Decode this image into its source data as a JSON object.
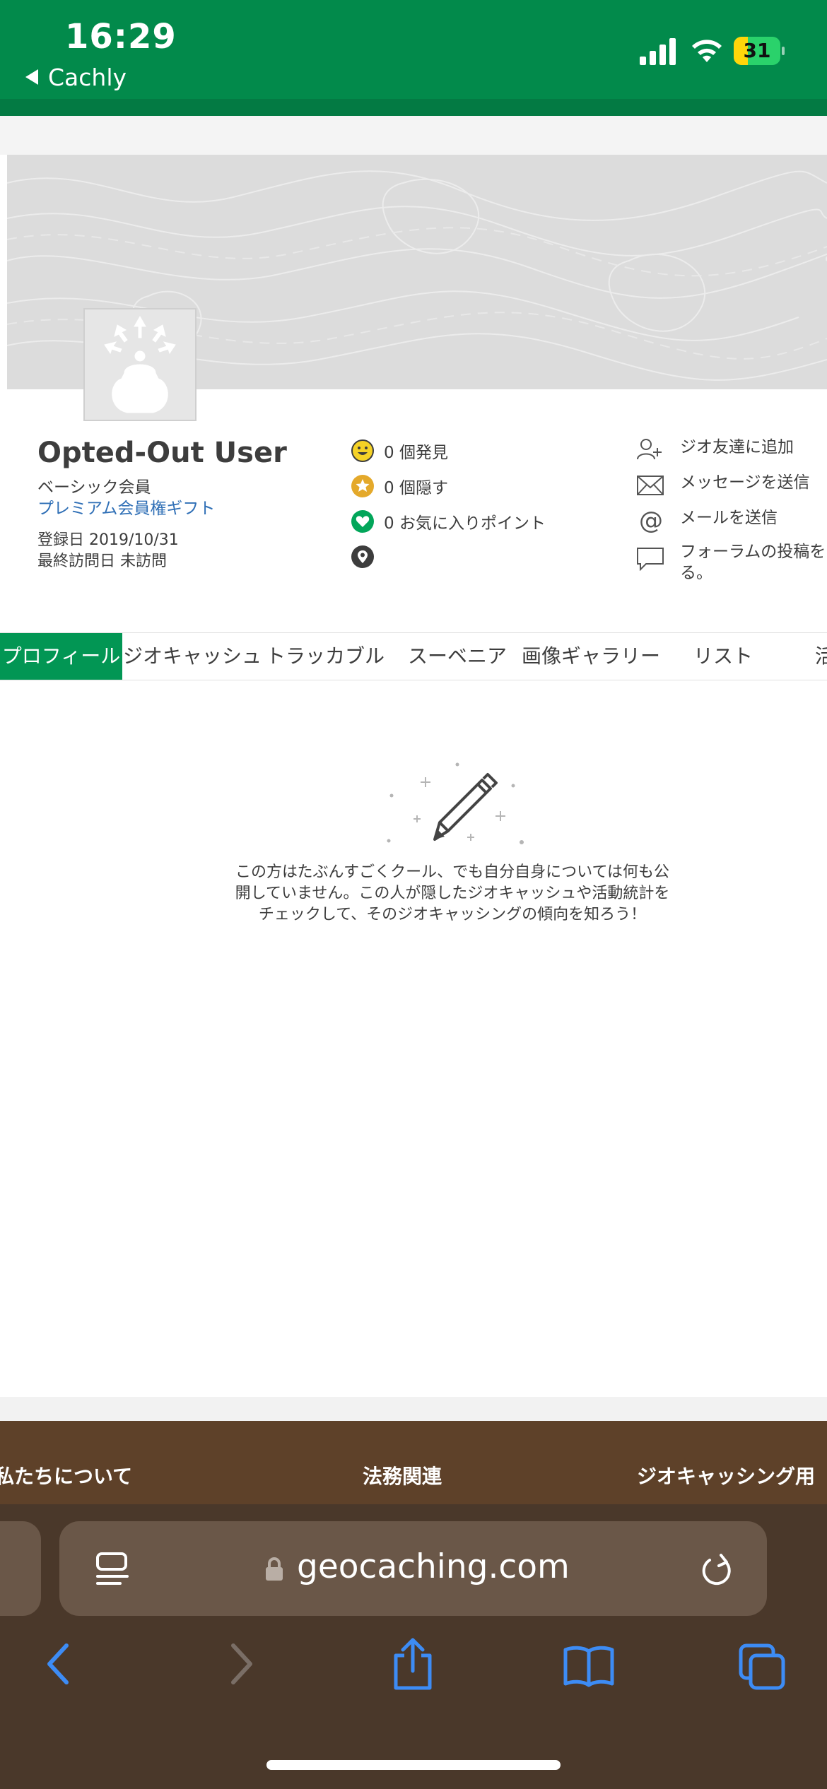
{
  "status_bar": {
    "time": "16:29",
    "back_label": "Cachly",
    "battery_percent": "31",
    "battery_level": 0.31
  },
  "profile": {
    "name": "Opted-Out User",
    "membership": "ベーシック会員",
    "gift_link": "プレミアム会員権ギフト",
    "joined": "登録日 2019/10/31",
    "last_visit": "最終訪問日 未訪問"
  },
  "stats": [
    {
      "icon": "smiley-icon",
      "label": "0 個発見"
    },
    {
      "icon": "star-icon",
      "label": "0 個隠す"
    },
    {
      "icon": "heart-icon",
      "label": "0 お気に入りポイント"
    },
    {
      "icon": "location-pin-icon",
      "label": ""
    }
  ],
  "actions": [
    {
      "icon": "add-friend-icon",
      "label": "ジオ友達に追加"
    },
    {
      "icon": "envelope-icon",
      "label": "メッセージを送信"
    },
    {
      "icon": "at-sign-icon",
      "label": "メールを送信"
    },
    {
      "icon": "speech-bubble-icon",
      "label_line1": "フォーラムの投稿を",
      "label_line2": "る。"
    }
  ],
  "tabs": [
    "プロフィール",
    "ジオキャッシュ",
    "トラッカブル",
    "スーベニア",
    "画像ギャラリー",
    "リスト",
    "活"
  ],
  "active_tab": "プロフィール",
  "empty_state": {
    "message": "この方はたぶんすごくクール、でも自分自身については何も公開していません。この人が隠したジオキャッシュや活動統計をチェックして、そのジオキャッシングの傾向を知ろう！"
  },
  "footer": {
    "links": [
      "私たちについて",
      "法務関連",
      "ジオキャッシング用"
    ]
  },
  "browser": {
    "url": "geocaching.com"
  },
  "colors": {
    "brand_green": "#028a4b",
    "active_tab": "#029654",
    "link_blue": "#2f6fb6",
    "footer_brown": "#5e4129",
    "toolbar_brown": "#4a382a",
    "toolbar_blue": "#3d8cf5"
  }
}
